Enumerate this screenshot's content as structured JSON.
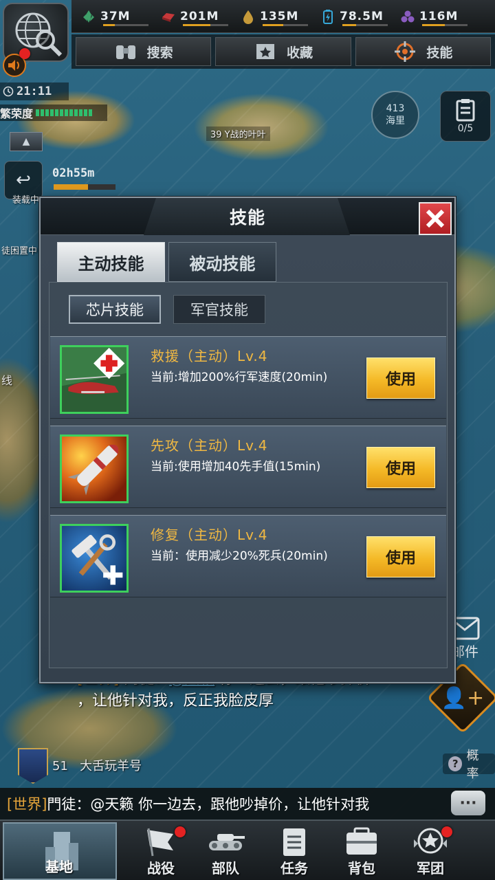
{
  "resources": [
    {
      "name": "crystal",
      "value": "37M",
      "color": "#3fa06a",
      "fill": 0.25
    },
    {
      "name": "metal",
      "value": "201M",
      "color": "#c6383a",
      "fill": 0.6
    },
    {
      "name": "oil",
      "value": "135M",
      "color": "#c69a3a",
      "fill": 0.45
    },
    {
      "name": "energy",
      "value": "78.5M",
      "color": "#36a8d8",
      "fill": 0.3
    },
    {
      "name": "rare",
      "value": "116M",
      "color": "#8a5cc0",
      "fill": 0.5
    }
  ],
  "top_actions": {
    "search": "搜索",
    "favorite": "收藏",
    "skill": "技能"
  },
  "left_panel": {
    "clock": "21:11",
    "prosperity_label": "繁荣度",
    "timer": "02h55m",
    "timer_fill": 0.55,
    "tag_supply": "装载中",
    "tag_sleep": "徒困置中",
    "tag_line": "线"
  },
  "map": {
    "distance_value": "413",
    "distance_unit": "海里",
    "task_count": "0/5",
    "island_label": "39  Y战的叶叶"
  },
  "modal": {
    "title": "技能",
    "tabs": [
      "主动技能",
      "被动技能"
    ],
    "subtabs": [
      "芯片技能",
      "军官技能"
    ],
    "use_label": "使用",
    "skills": [
      {
        "name": "救援（主动）Lv.4",
        "desc": "当前:增加200%行军速度(20min)",
        "icon": "rescue-helicopter-icon"
      },
      {
        "name": "先攻（主动）Lv.4",
        "desc": "当前:使用增加40先手值(15min)",
        "icon": "missile-icon"
      },
      {
        "name": "修复（主动）Lv.4",
        "desc": "当前：使用减少20%死兵(20min)",
        "icon": "repair-tools-icon"
      }
    ]
  },
  "chat_overlay": {
    "channel": "[世界]",
    "sender": "門徒：",
    "mention": "@天籁",
    "line1": " 你一边去，跟他吵掉价",
    "line2": "，让他针对我，反正我脸皮厚"
  },
  "base_label": {
    "level": "51",
    "name": "大舌玩羊号"
  },
  "chat_strip": {
    "channel": "[世界]",
    "text": "門徒：@天籁  你一边去，跟他吵掉价，让他针对我"
  },
  "side": {
    "mail_label": "邮件",
    "probability": "概率"
  },
  "bottom_nav": {
    "base": "基地",
    "battle": "战役",
    "troops": "部队",
    "tasks": "任务",
    "bag": "背包",
    "legion": "军团"
  }
}
